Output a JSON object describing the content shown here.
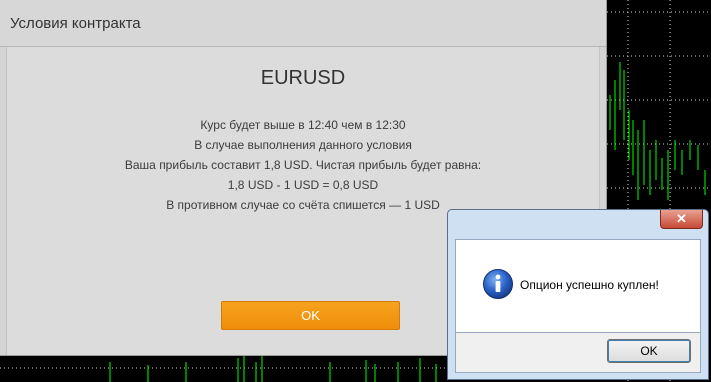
{
  "contract_dialog": {
    "title": "Условия контракта",
    "symbol": "EURUSD",
    "terms": [
      "Курс будет выше в 12:40 чем в 12:30",
      "В случае выполнения данного условия",
      "Ваша прибыль составит 1,8 USD. Чистая прибыль будет равна:",
      "1,8 USD - 1 USD = 0,8 USD",
      "В противном случае со счёта спишется — 1 USD"
    ],
    "ok_label": "OK",
    "accent_color": "#f39814"
  },
  "message_box": {
    "close_symbol": "✕",
    "icon": "info-icon",
    "message": "Опцион успешно куплен!",
    "ok_label": "OK"
  },
  "background_chart": {
    "background_color": "#000000",
    "candle_color": "#00ff00",
    "grid_color": "#d0d0d0"
  }
}
